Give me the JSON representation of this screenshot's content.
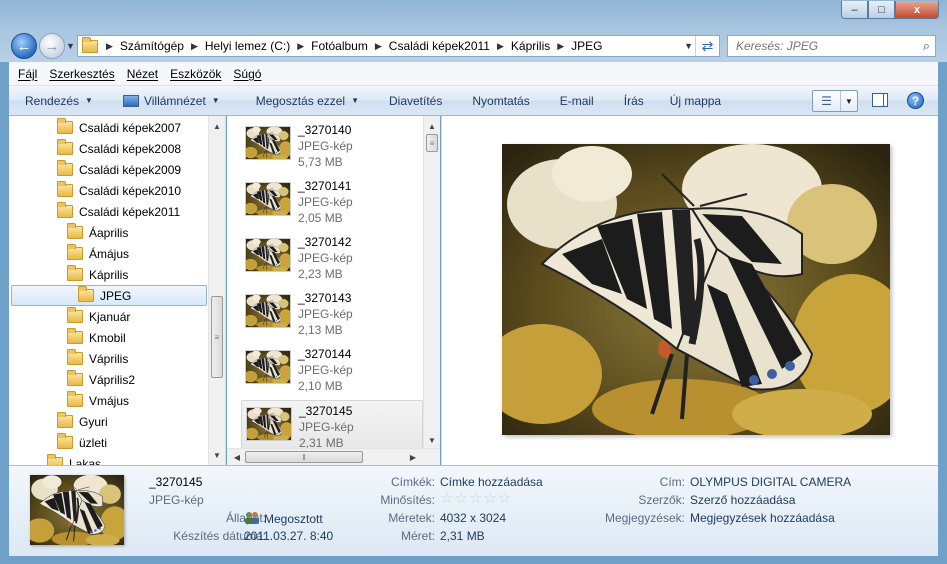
{
  "window": {
    "controls": {
      "minimize": "–",
      "maximize": "□",
      "close": "x"
    }
  },
  "address": {
    "breadcrumbs": [
      "Számítógép",
      "Helyi lemez (C:)",
      "Fotóalbum",
      "Családi képek2011",
      "Káprilis",
      "JPEG"
    ],
    "search_placeholder": "Keresés: JPEG"
  },
  "menubar": [
    "Fájl",
    "Szerkesztés",
    "Nézet",
    "Eszközök",
    "Súgó"
  ],
  "toolbar": {
    "organize": "Rendezés",
    "slideshow": "Villámnézet",
    "share": "Megosztás ezzel",
    "slideshow2": "Diavetítés",
    "print": "Nyomtatás",
    "email": "E-mail",
    "burn": "Írás",
    "new_folder": "Új mappa"
  },
  "nav_tree": [
    {
      "label": "Családi képek2007",
      "level": 1
    },
    {
      "label": "Családi képek2008",
      "level": 1
    },
    {
      "label": "Családi képek2009",
      "level": 1
    },
    {
      "label": "Családi képek2010",
      "level": 1
    },
    {
      "label": "Családi képek2011",
      "level": 1
    },
    {
      "label": "Áaprilis",
      "level": 2
    },
    {
      "label": "Ámájus",
      "level": 2
    },
    {
      "label": "Káprilis",
      "level": 2
    },
    {
      "label": "JPEG",
      "level": 3,
      "selected": true
    },
    {
      "label": "Kjanuár",
      "level": 2
    },
    {
      "label": "Kmobil",
      "level": 2
    },
    {
      "label": "Váprilis",
      "level": 2
    },
    {
      "label": "Váprilis2",
      "level": 2
    },
    {
      "label": "Vmájus",
      "level": 2
    },
    {
      "label": "Gyuri",
      "level": 1
    },
    {
      "label": "üzleti",
      "level": 1
    },
    {
      "label": "Lakas",
      "level": 0
    }
  ],
  "files": [
    {
      "name": "_3270140",
      "type": "JPEG-kép",
      "size": "5,73 MB"
    },
    {
      "name": "_3270141",
      "type": "JPEG-kép",
      "size": "2,05 MB"
    },
    {
      "name": "_3270142",
      "type": "JPEG-kép",
      "size": "2,23 MB"
    },
    {
      "name": "_3270143",
      "type": "JPEG-kép",
      "size": "2,13 MB"
    },
    {
      "name": "_3270144",
      "type": "JPEG-kép",
      "size": "2,10 MB"
    },
    {
      "name": "_3270145",
      "type": "JPEG-kép",
      "size": "2,31 MB",
      "selected": true
    }
  ],
  "details": {
    "name": "_3270145",
    "type": "JPEG-kép",
    "status_label": "Állapot:",
    "status_value": "Megosztott",
    "date_label": "Készítés dátuma:",
    "date_value": "2011.03.27. 8:40",
    "tags_label": "Címkék:",
    "tags_value": "Címke hozzáadása",
    "rating_label": "Minősítés:",
    "rating_value": 0,
    "dimensions_label": "Méretek:",
    "dimensions_value": "4032 x 3024",
    "size_label": "Méret:",
    "size_value": "2,31 MB",
    "title_label": "Cím:",
    "title_value": "OLYMPUS DIGITAL CAMERA",
    "authors_label": "Szerzők:",
    "authors_value": "Szerző hozzáadása",
    "comments_label": "Megjegyzések:",
    "comments_value": "Megjegyzések hozzáadása"
  },
  "icons": {
    "back": "back-arrow-icon",
    "forward": "forward-arrow-icon",
    "refresh": "refresh-icon",
    "search": "search-icon",
    "help": "help-icon",
    "folder": "folder-icon"
  },
  "colors": {
    "accent": "#1e395b",
    "selection": "#d9e8f9",
    "frame": "#a9c6e0"
  }
}
